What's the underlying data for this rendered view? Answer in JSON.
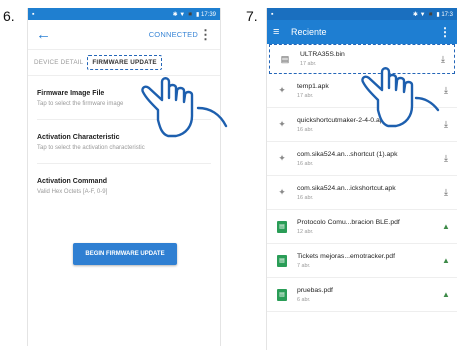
{
  "steps": {
    "left": "6.",
    "right": "7."
  },
  "status_left": {
    "indicators": "✱ ▼ ◾ ▮ 17:39"
  },
  "status_right": {
    "indicators": "✱ ▼ ◾ ▮ 17:3"
  },
  "left_screen": {
    "header": {
      "connected_label": "CONNECTED"
    },
    "tabs": [
      "DEVICE DETAIL",
      "FIRMWARE UPDATE"
    ],
    "sections": [
      {
        "title": "Firmware Image File",
        "hint": "Tap to select the firmware image"
      },
      {
        "title": "Activation Characteristic",
        "hint": "Tap to select the activation characteristic"
      },
      {
        "title": "Activation Command",
        "hint": "Valid Hex Octets [A-F, 0-9]"
      }
    ],
    "button_label": "BEGIN FIRMWARE UPDATE"
  },
  "right_screen": {
    "header": {
      "title": "Reciente"
    },
    "files": [
      {
        "name": "ULTRA35S.bin",
        "age": "17 abr.",
        "icon": "file-icon",
        "action": "download-icon"
      },
      {
        "name": "temp1.apk",
        "age": "17 abr.",
        "icon": "android-icon",
        "action": "download-icon"
      },
      {
        "name": "quickshortcutmaker-2-4-0.apk",
        "age": "16 abr.",
        "icon": "android-icon",
        "action": "download-icon"
      },
      {
        "name": "com.sika524.an...shortcut (1).apk",
        "age": "16 abr.",
        "icon": "android-icon",
        "action": "download-icon"
      },
      {
        "name": "com.sika524.an...ickshortcut.apk",
        "age": "16 abr.",
        "icon": "android-icon",
        "action": "download-icon"
      },
      {
        "name": "Protocolo Comu...bracion BLE.pdf",
        "age": "12 abr.",
        "icon": "pdf-icon",
        "action": "drive-icon"
      },
      {
        "name": "Tickets mejoras...emotracker.pdf",
        "age": "7 abr.",
        "icon": "pdf-icon",
        "action": "drive-icon"
      },
      {
        "name": "pruebas.pdf",
        "age": "6 abr.",
        "icon": "pdf-icon",
        "action": "drive-icon"
      }
    ]
  }
}
